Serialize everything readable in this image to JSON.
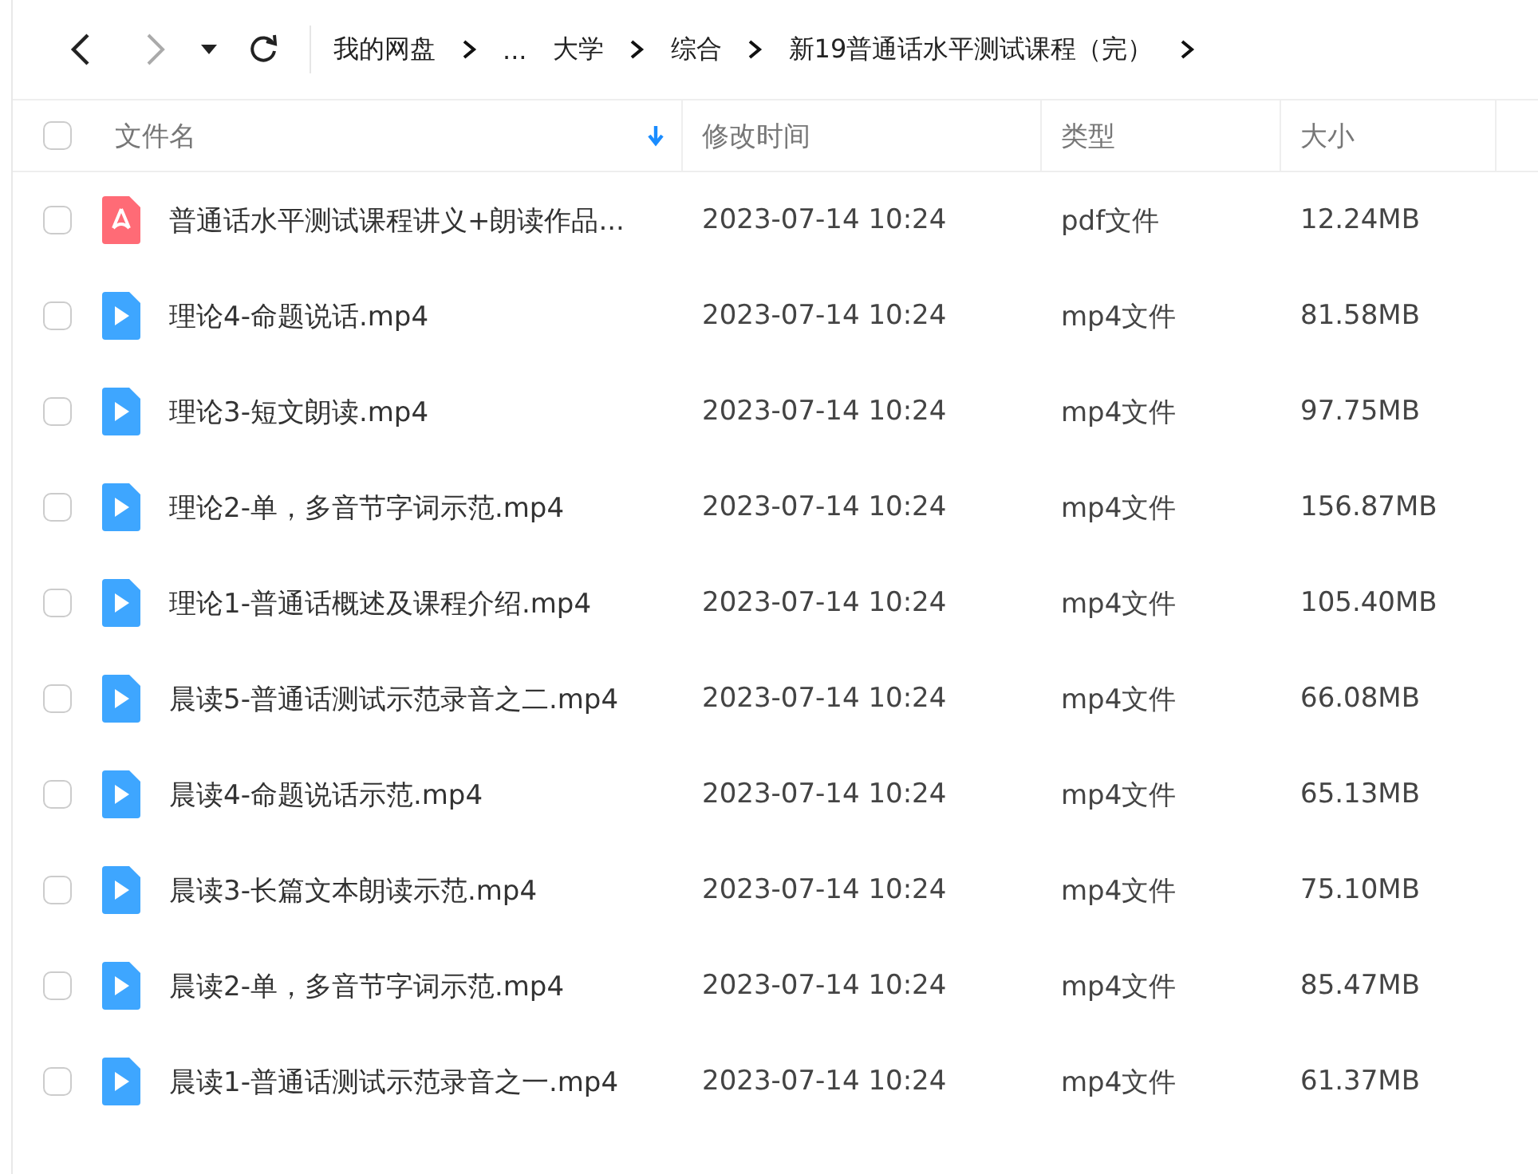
{
  "toolbar": {
    "breadcrumbs": [
      "我的网盘",
      "...",
      "大学",
      "综合",
      "新19普通话水平测试课程（完）"
    ]
  },
  "table": {
    "columns": [
      "文件名",
      "修改时间",
      "类型",
      "大小"
    ],
    "select_all": {
      "checked": false
    },
    "rows": [
      {
        "kind": "pdf",
        "name": "普通话水平测试课程讲义+朗读作品...",
        "time": "2023-07-14 10:24",
        "type": "pdf文件",
        "size": "12.24MB",
        "checked": false
      },
      {
        "kind": "video",
        "name": "理论4-命题说话.mp4",
        "time": "2023-07-14 10:24",
        "type": "mp4文件",
        "size": "81.58MB",
        "checked": false
      },
      {
        "kind": "video",
        "name": "理论3-短文朗读.mp4",
        "time": "2023-07-14 10:24",
        "type": "mp4文件",
        "size": "97.75MB",
        "checked": false
      },
      {
        "kind": "video",
        "name": "理论2-单，多音节字词示范.mp4",
        "time": "2023-07-14 10:24",
        "type": "mp4文件",
        "size": "156.87MB",
        "checked": false
      },
      {
        "kind": "video",
        "name": "理论1-普通话概述及课程介绍.mp4",
        "time": "2023-07-14 10:24",
        "type": "mp4文件",
        "size": "105.40MB",
        "checked": false
      },
      {
        "kind": "video",
        "name": "晨读5-普通话测试示范录音之二.mp4",
        "time": "2023-07-14 10:24",
        "type": "mp4文件",
        "size": "66.08MB",
        "checked": false
      },
      {
        "kind": "video",
        "name": "晨读4-命题说话示范.mp4",
        "time": "2023-07-14 10:24",
        "type": "mp4文件",
        "size": "65.13MB",
        "checked": false
      },
      {
        "kind": "video",
        "name": "晨读3-长篇文本朗读示范.mp4",
        "time": "2023-07-14 10:24",
        "type": "mp4文件",
        "size": "75.10MB",
        "checked": false
      },
      {
        "kind": "video",
        "name": "晨读2-单，多音节字词示范.mp4",
        "time": "2023-07-14 10:24",
        "type": "mp4文件",
        "size": "85.47MB",
        "checked": false
      },
      {
        "kind": "video",
        "name": "晨读1-普通话测试示范录音之一.mp4",
        "time": "2023-07-14 10:24",
        "type": "mp4文件",
        "size": "61.37MB",
        "checked": false
      }
    ]
  }
}
